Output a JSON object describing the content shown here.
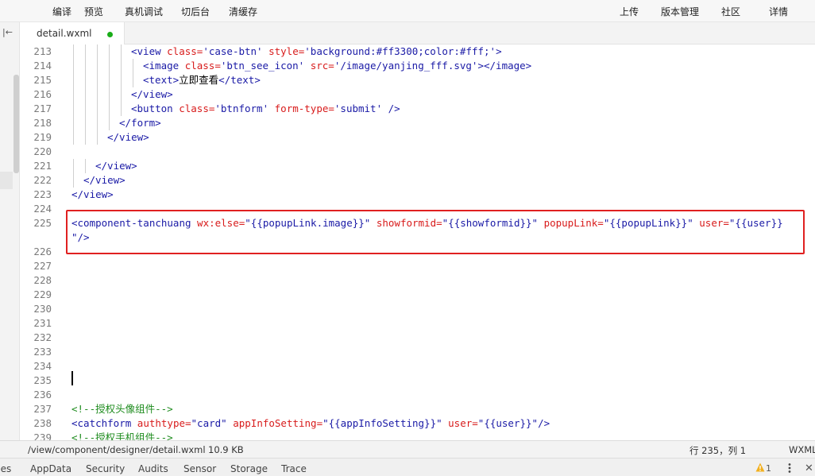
{
  "toolbar": {
    "left": [
      "编译",
      "预览",
      "真机调试",
      "切后台",
      "清缓存"
    ],
    "right": [
      "上传",
      "版本管理",
      "社区",
      "详情"
    ]
  },
  "tab": {
    "label": "detail.wxml",
    "dot_color": "#1aad19"
  },
  "editor": {
    "lines": [
      {
        "n": "213",
        "indent": 5,
        "tokens": [
          [
            "tag",
            "<view "
          ],
          [
            "attr",
            "class="
          ],
          [
            "str",
            "'case-btn' "
          ],
          [
            "attr",
            "style="
          ],
          [
            "str",
            "'background:#ff3300;color:#fff;'"
          ],
          [
            "tag",
            ">"
          ]
        ]
      },
      {
        "n": "214",
        "indent": 6,
        "tokens": [
          [
            "tag",
            "<image "
          ],
          [
            "attr",
            "class="
          ],
          [
            "str",
            "'btn_see_icon' "
          ],
          [
            "attr",
            "src="
          ],
          [
            "str",
            "'/image/yanjing_fff.svg'"
          ],
          [
            "tag",
            "></image>"
          ]
        ]
      },
      {
        "n": "215",
        "indent": 6,
        "tokens": [
          [
            "tag",
            "<text>"
          ],
          [
            "text",
            "立即查看"
          ],
          [
            "tag",
            "</text>"
          ]
        ]
      },
      {
        "n": "216",
        "indent": 5,
        "tokens": [
          [
            "tag",
            "</view>"
          ]
        ]
      },
      {
        "n": "217",
        "indent": 5,
        "tokens": [
          [
            "tag",
            "<button "
          ],
          [
            "attr",
            "class="
          ],
          [
            "str",
            "'btnform' "
          ],
          [
            "attr",
            "form-type="
          ],
          [
            "str",
            "'submit' "
          ],
          [
            "tag",
            "/>"
          ]
        ]
      },
      {
        "n": "218",
        "indent": 4,
        "tokens": [
          [
            "tag",
            "</form>"
          ]
        ]
      },
      {
        "n": "219",
        "indent": 3,
        "tokens": [
          [
            "tag",
            "</view>"
          ]
        ]
      },
      {
        "n": "220",
        "indent": 0,
        "tokens": []
      },
      {
        "n": "221",
        "indent": 2,
        "tokens": [
          [
            "tag",
            "</view>"
          ]
        ]
      },
      {
        "n": "222",
        "indent": 1,
        "tokens": [
          [
            "tag",
            "</view>"
          ]
        ]
      },
      {
        "n": "223",
        "indent": 0,
        "tokens": [
          [
            "tag",
            "</view>"
          ]
        ]
      },
      {
        "n": "224",
        "indent": 0,
        "tokens": []
      },
      {
        "n": "225",
        "indent": 0,
        "tokens": [
          [
            "tag",
            "<component-tanchuang "
          ],
          [
            "attr",
            "wx:else="
          ],
          [
            "str",
            "\"{{popupLink.image}}\" "
          ],
          [
            "attr",
            "showformid="
          ],
          [
            "str",
            "\"{{showformid}}\" "
          ],
          [
            "attr",
            "popupLink="
          ],
          [
            "str",
            "\"{{popupLink}}\" "
          ],
          [
            "attr",
            "user="
          ],
          [
            "str",
            "\"{{user}}"
          ]
        ]
      },
      {
        "n": "",
        "indent": 0,
        "tokens": [
          [
            "str",
            "\""
          ],
          [
            "tag",
            "/>"
          ]
        ]
      },
      {
        "n": "226",
        "indent": 0,
        "tokens": []
      },
      {
        "n": "227",
        "indent": 0,
        "tokens": []
      },
      {
        "n": "228",
        "indent": 0,
        "tokens": []
      },
      {
        "n": "229",
        "indent": 0,
        "tokens": []
      },
      {
        "n": "230",
        "indent": 0,
        "tokens": []
      },
      {
        "n": "231",
        "indent": 0,
        "tokens": []
      },
      {
        "n": "232",
        "indent": 0,
        "tokens": []
      },
      {
        "n": "233",
        "indent": 0,
        "tokens": []
      },
      {
        "n": "234",
        "indent": 0,
        "tokens": []
      },
      {
        "n": "235",
        "indent": 0,
        "tokens": []
      },
      {
        "n": "236",
        "indent": 0,
        "tokens": []
      },
      {
        "n": "237",
        "indent": 0,
        "tokens": [
          [
            "com",
            "<!--授权头像组件-->"
          ]
        ]
      },
      {
        "n": "238",
        "indent": 0,
        "tokens": [
          [
            "tag",
            "<catchform "
          ],
          [
            "attr",
            "authtype="
          ],
          [
            "str",
            "\"card\" "
          ],
          [
            "attr",
            "appInfoSetting="
          ],
          [
            "str",
            "\"{{appInfoSetting}}\" "
          ],
          [
            "attr",
            "user="
          ],
          [
            "str",
            "\"{{user}}\""
          ],
          [
            "tag",
            "/>"
          ]
        ]
      },
      {
        "n": "239",
        "indent": 0,
        "tokens": [
          [
            "com",
            "<!--授权手机组件-->"
          ]
        ]
      }
    ]
  },
  "status": {
    "path": "/view/component/designer/detail.wxml",
    "size": "10.9 KB",
    "position": "行 235，列 1",
    "language": "WXML"
  },
  "panel": {
    "tabs": [
      "ces",
      "AppData",
      "Security",
      "Audits",
      "Sensor",
      "Storage",
      "Trace"
    ],
    "warning_count": "1"
  },
  "colors": {
    "tag": "#1a1aa6",
    "attr": "#d81b1b",
    "str": "#1a1aa6",
    "text": "#000000",
    "com": "#1f8c1f",
    "highlight": "#e02020"
  }
}
